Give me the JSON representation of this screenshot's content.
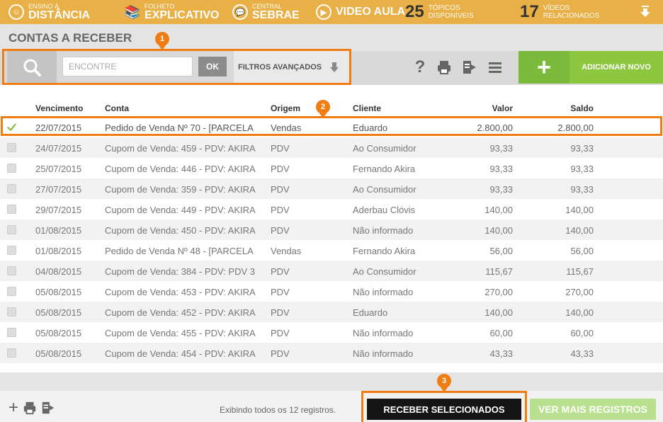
{
  "topbar": {
    "ead_small": "ENSINO À",
    "ead_big": "DISTÂNCIA",
    "folheto_small": "FOLHETO",
    "folheto_big": "EXPLICATIVO",
    "central_small": "CENTRAL",
    "central_big": "SEBRAE",
    "video_label": "VIDEO AULA",
    "topics_count": "25",
    "topics_line1": "TÓPICOS",
    "topics_line2": "DISPONÍVEIS",
    "videos_count": "17",
    "videos_line1": "VÍDEOS",
    "videos_line2": "RELACIONADOS"
  },
  "page_title": "CONTAS A RECEBER",
  "toolbar": {
    "search_placeholder": "ENCONTRE",
    "ok_label": "OK",
    "filters_label": "FILTROS AVANÇADOS",
    "help_label": "?",
    "add_label": "ADICIONAR NOVO"
  },
  "badges": [
    "1",
    "2",
    "3"
  ],
  "table": {
    "headers": {
      "vencimento": "Vencimento",
      "conta": "Conta",
      "origem": "Origem",
      "cliente": "Cliente",
      "valor": "Valor",
      "saldo": "Saldo"
    },
    "rows": [
      {
        "vencimento": "22/07/2015",
        "conta": "Pedido de Venda Nº 70 - [PARCELA",
        "origem": "Vendas",
        "cliente": "Eduardo",
        "valor": "2.800,00",
        "saldo": "2.800,00",
        "checked": true
      },
      {
        "vencimento": "24/07/2015",
        "conta": "Cupom de Venda: 459 - PDV: AKIRA",
        "origem": "PDV",
        "cliente": "Ao Consumidor",
        "valor": "93,33",
        "saldo": "93,33",
        "checked": false
      },
      {
        "vencimento": "25/07/2015",
        "conta": "Cupom de Venda: 446 - PDV: AKIRA",
        "origem": "PDV",
        "cliente": "Fernando Akira",
        "valor": "93,33",
        "saldo": "93,33",
        "checked": false
      },
      {
        "vencimento": "27/07/2015",
        "conta": "Cupom de Venda: 359 - PDV: AKIRA",
        "origem": "PDV",
        "cliente": "Ao Consumidor",
        "valor": "93,33",
        "saldo": "93,33",
        "checked": false
      },
      {
        "vencimento": "29/07/2015",
        "conta": "Cupom de Venda: 449 - PDV: AKIRA",
        "origem": "PDV",
        "cliente": "Aderbau Clóvis",
        "valor": "140,00",
        "saldo": "140,00",
        "checked": false
      },
      {
        "vencimento": "01/08/2015",
        "conta": "Cupom de Venda: 450 - PDV: AKIRA",
        "origem": "PDV",
        "cliente": "Não informado",
        "valor": "140,00",
        "saldo": "140,00",
        "checked": false
      },
      {
        "vencimento": "01/08/2015",
        "conta": "Pedido de Venda Nº 48 - [PARCELA",
        "origem": "Vendas",
        "cliente": "Fernando Akira",
        "valor": "56,00",
        "saldo": "56,00",
        "checked": false
      },
      {
        "vencimento": "04/08/2015",
        "conta": "Cupom de Venda: 384 - PDV: PDV 3",
        "origem": "PDV",
        "cliente": "Ao Consumidor",
        "valor": "115,67",
        "saldo": "115,67",
        "checked": false
      },
      {
        "vencimento": "05/08/2015",
        "conta": "Cupom de Venda: 453 - PDV: AKIRA",
        "origem": "PDV",
        "cliente": "Não informado",
        "valor": "270,00",
        "saldo": "270,00",
        "checked": false
      },
      {
        "vencimento": "05/08/2015",
        "conta": "Cupom de Venda: 452 - PDV: AKIRA",
        "origem": "PDV",
        "cliente": "Eduardo",
        "valor": "140,00",
        "saldo": "140,00",
        "checked": false
      },
      {
        "vencimento": "05/08/2015",
        "conta": "Cupom de Venda: 455 - PDV: AKIRA",
        "origem": "PDV",
        "cliente": "Não informado",
        "valor": "60,00",
        "saldo": "60,00",
        "checked": false
      },
      {
        "vencimento": "05/08/2015",
        "conta": "Cupom de Venda: 454 - PDV: AKIRA",
        "origem": "PDV",
        "cliente": "Não informado",
        "valor": "43,33",
        "saldo": "43,33",
        "checked": false
      }
    ]
  },
  "footer": {
    "count_text": "Exibindo todos os 12 registros.",
    "receive_label": "RECEBER SELECIONADOS",
    "more_label": "VER MAIS REGISTROS"
  },
  "colors": {
    "accent": "#f07d13",
    "topbar": "#e8b046",
    "add_green": "#7cba3b",
    "receive_black": "#151515",
    "more_light_green": "#b9e08e"
  }
}
